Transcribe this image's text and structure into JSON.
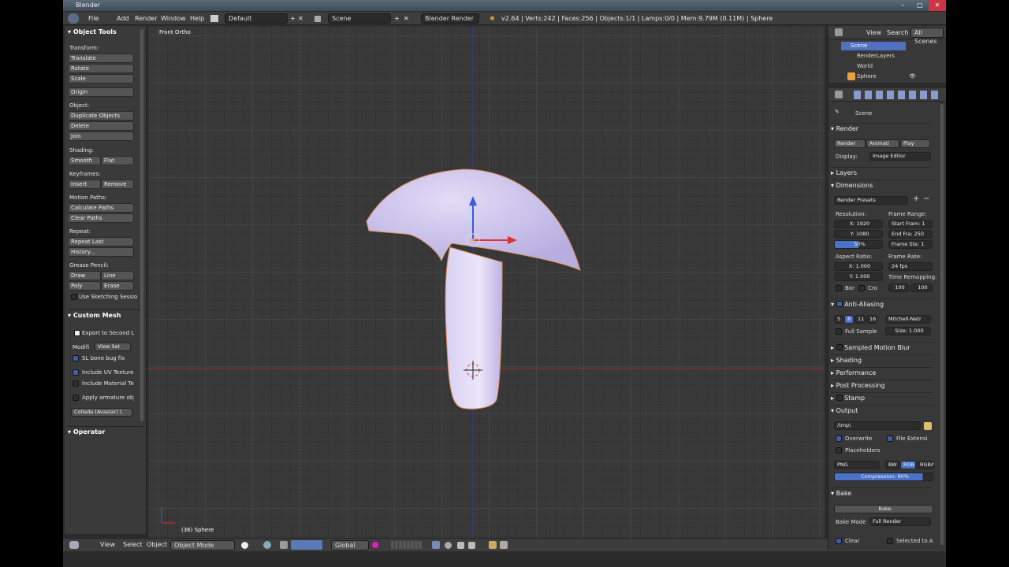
{
  "window": {
    "title": "Blender",
    "controls": [
      "–",
      "□",
      "✕"
    ]
  },
  "menubar": {
    "menus": [
      "File",
      "Add",
      "Render",
      "Window",
      "Help"
    ],
    "layout": "Default",
    "scene": "Scene",
    "engine": "Blender Render",
    "stats": "v2.64 | Verts:242 | Faces:256 | Objects:1/1 | Lamps:0/0 | Mem:9.79M (0.11M) | Sphere"
  },
  "toolshelf": {
    "header": "Object Tools",
    "transform": {
      "label": "Transform:",
      "buttons": [
        "Translate",
        "Rotate",
        "Scale"
      ]
    },
    "origin": "Origin",
    "object": {
      "label": "Object:",
      "buttons": [
        "Duplicate Objects",
        "Delete",
        "Join"
      ]
    },
    "shading": {
      "label": "Shading:",
      "smooth": "Smooth",
      "flat": "Flat"
    },
    "keyframes": {
      "label": "Keyframes:",
      "insert": "Insert",
      "remove": "Remove"
    },
    "motion": {
      "label": "Motion Paths:",
      "calculate": "Calculate Paths",
      "clear": "Clear Paths"
    },
    "repeat": {
      "label": "Repeat:",
      "last": "Repeat Last",
      "history": "History..."
    },
    "grease": {
      "label": "Grease Pencil:",
      "draw": "Draw",
      "line": "Line",
      "poly": "Poly",
      "erase": "Erase",
      "sketch": "Use Sketching Sessio"
    },
    "custom_mesh": {
      "header": "Custom Mesh",
      "export": "Export to Second Li",
      "modifi": "Modifi",
      "view_set": "View Set",
      "bone_fix": "SL bone bug fix",
      "uv": "Include UV Texture",
      "material": "Include Material Te",
      "armature": "Apply armature obj",
      "collada": "Collada (Avastar) (."
    },
    "operator": "Operator"
  },
  "viewport": {
    "view_name": "Front Ortho",
    "object_info": "(36) Sphere",
    "mesh_color": "#d4c8f0"
  },
  "bottombar": {
    "menus": [
      "View",
      "Select",
      "Object"
    ],
    "mode": "Object Mode",
    "orientation": "Global"
  },
  "outliner": {
    "menus": [
      "View",
      "Search"
    ],
    "filter": "All Scenes",
    "items": [
      "Scene",
      "RenderLayers",
      "World",
      "Sphere"
    ]
  },
  "properties": {
    "context": "Scene",
    "render": {
      "header": "Render",
      "render_btn": "Render",
      "animation_btn": "Animati",
      "play_btn": "Play",
      "display_label": "Display:",
      "display_value": "Image Editor"
    },
    "layers": "Layers",
    "dimensions": {
      "header": "Dimensions",
      "presets": "Render Presets",
      "res_label": "Resolution:",
      "x": "X: 1920",
      "y": "Y: 1080",
      "pct": "50%",
      "fr_label": "Frame Range:",
      "start": "Start Fram: 1",
      "end": "End Fra: 250",
      "step": "Frame Ste: 1",
      "aspect_label": "Aspect Ratio:",
      "ax": "X: 1.000",
      "ay": "Y: 1.000",
      "rate_label": "Frame Rate:",
      "fps": "24 fps",
      "remap_label": "Time Remapping:",
      "remap_old": "100",
      "remap_new": "100",
      "bor": "Bor",
      "cro": "Cro"
    },
    "aa": {
      "header": "Anti-Aliasing",
      "samples": [
        "5",
        "8",
        "11",
        "16"
      ],
      "filter": "Mitchell-Netr",
      "full": "Full Sample",
      "size": "Size: 1.000"
    },
    "closed": [
      "Sampled Motion Blur",
      "Shading",
      "Performance",
      "Post Processing",
      "Stamp"
    ],
    "output": {
      "header": "Output",
      "path": "/tmp\\",
      "overwrite": "Overwrite",
      "file_ext": "File Extensi",
      "placeholders": "Placeholders",
      "format": "PNG",
      "bw": "BW",
      "rgb": "RGB",
      "rgba": "RGBA",
      "compression": "Compression: 90%"
    },
    "bake": {
      "header": "Bake",
      "bake_btn": "Bake",
      "mode_label": "Bake Mode",
      "mode_value": "Full Render",
      "clear": "Clear",
      "selected": "Selected to A"
    }
  }
}
